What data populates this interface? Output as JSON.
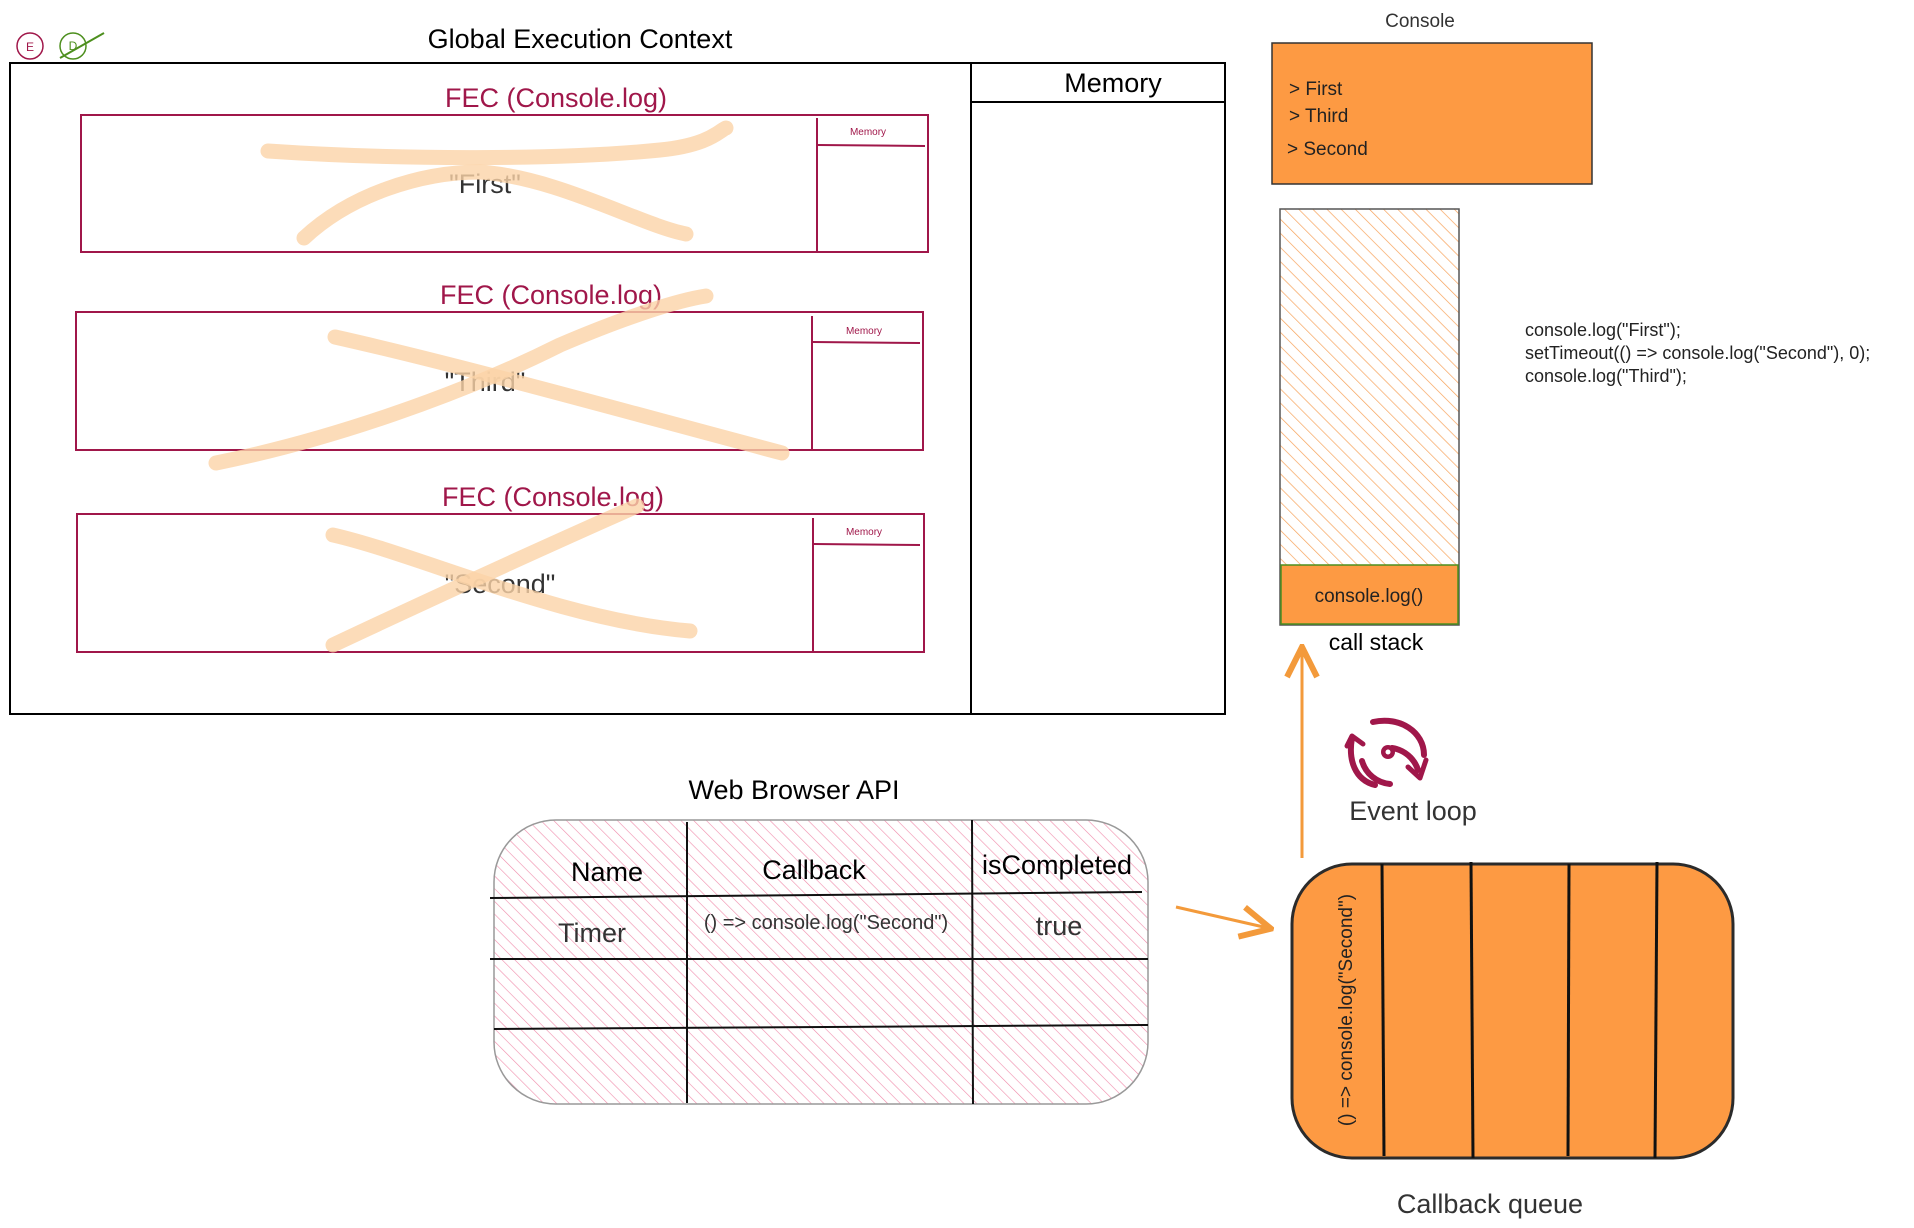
{
  "legend": {
    "e_badge": "E",
    "d_badge": "D"
  },
  "global_context": {
    "title": "Global Execution Context",
    "memory_label": "Memory",
    "fecs": [
      {
        "title": "FEC (Console.log)",
        "value": "\"First\"",
        "memory_label": "Memory"
      },
      {
        "title": "FEC (Console.log)",
        "value": "\"Third\"",
        "memory_label": "Memory"
      },
      {
        "title": "FEC (Console.log)",
        "value": "\"Second\"",
        "memory_label": "Memory"
      }
    ]
  },
  "console": {
    "title": "Console",
    "lines": [
      "> First",
      "> Third",
      "> Second"
    ]
  },
  "call_stack": {
    "top_frame": "console.log()",
    "label": "call stack"
  },
  "code": {
    "lines": [
      "console.log(\"First\");",
      "setTimeout(() => console.log(\"Second\"), 0);",
      "console.log(\"Third\");"
    ]
  },
  "event_loop": {
    "label": "Event loop"
  },
  "web_api": {
    "title": "Web Browser API",
    "headers": [
      "Name",
      "Callback",
      "isCompleted"
    ],
    "rows": [
      [
        "Timer",
        "() => console.log(\"Second\")",
        "true"
      ],
      [
        "",
        "",
        ""
      ],
      [
        "",
        "",
        ""
      ]
    ]
  },
  "callback_queue": {
    "label": "Callback queue",
    "items": [
      "() => console.log(\"Second\")"
    ]
  },
  "colors": {
    "crimson": "#a0174a",
    "orange": "#fd9a43",
    "highlight": "#fbd3a8",
    "pink_hatch": "#f08aaa",
    "green": "#4d8f1e",
    "dark": "#222222"
  }
}
